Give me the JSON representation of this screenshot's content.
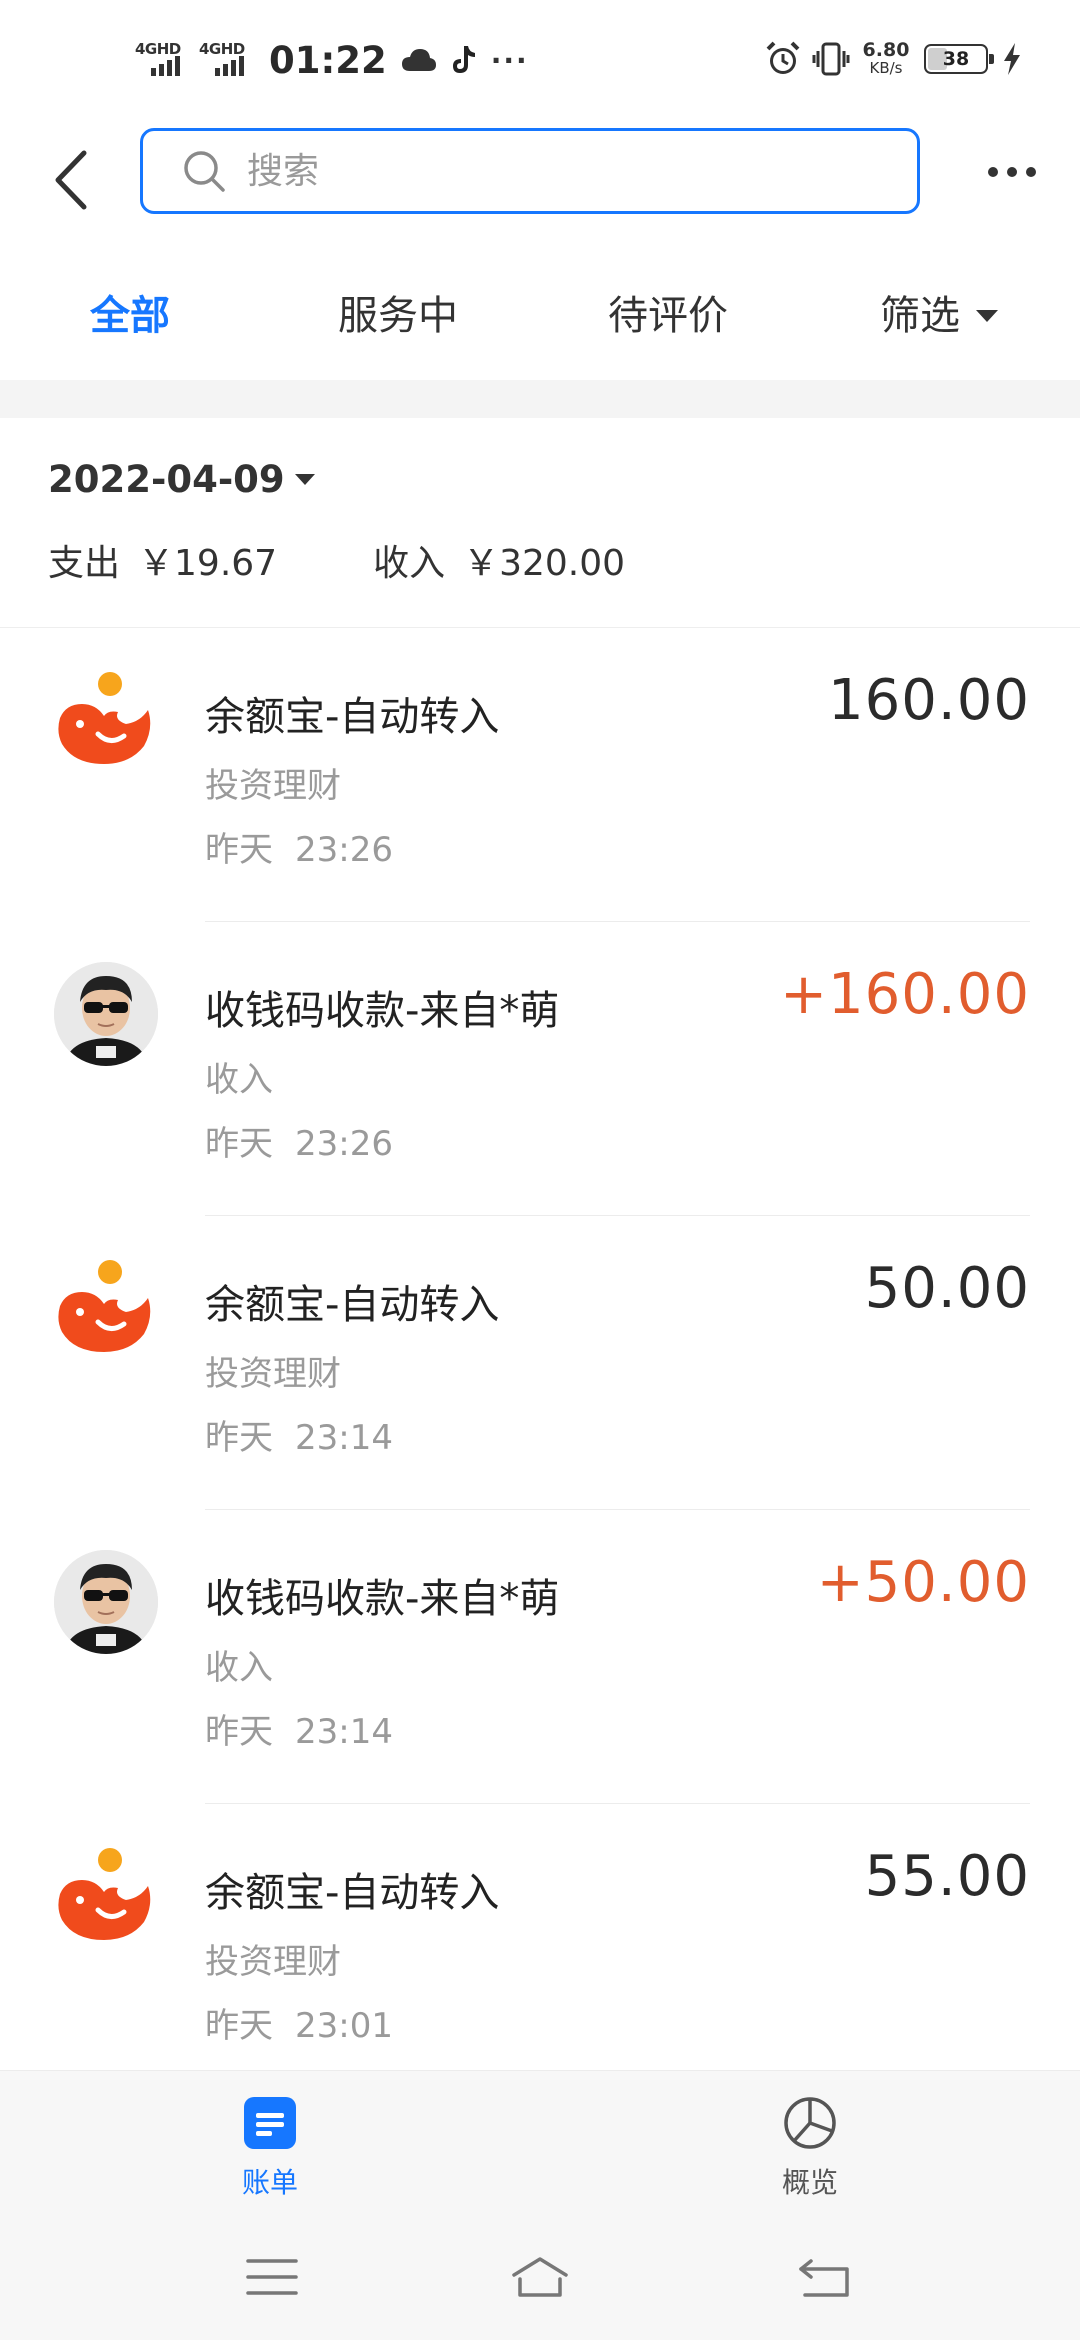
{
  "status_bar": {
    "network_1": "4GHD",
    "network_2": "4GHD",
    "time": "01:22",
    "overflow": "···",
    "speed_value": "6.80",
    "speed_unit": "KB/s",
    "battery": "38"
  },
  "header": {
    "search_placeholder": "搜索"
  },
  "tabs": [
    {
      "label": "全部",
      "active": true
    },
    {
      "label": "服务中",
      "active": false
    },
    {
      "label": "待评价",
      "active": false
    },
    {
      "label": "筛选",
      "active": false
    }
  ],
  "summary": {
    "date": "2022-04-09",
    "expense_label": "支出",
    "expense_value": "￥19.67",
    "income_label": "收入",
    "income_value": "￥320.00"
  },
  "transactions": [
    {
      "icon": "yuebao-icon",
      "title": "余额宝-自动转入",
      "category": "投资理财",
      "day": "昨天",
      "time": "23:26",
      "amount": "160.00",
      "type": "neutral"
    },
    {
      "icon": "user-avatar",
      "title": "收钱码收款-来自*萌",
      "category": "收入",
      "day": "昨天",
      "time": "23:26",
      "amount": "+160.00",
      "type": "income"
    },
    {
      "icon": "yuebao-icon",
      "title": "余额宝-自动转入",
      "category": "投资理财",
      "day": "昨天",
      "time": "23:14",
      "amount": "50.00",
      "type": "neutral"
    },
    {
      "icon": "user-avatar",
      "title": "收钱码收款-来自*萌",
      "category": "收入",
      "day": "昨天",
      "time": "23:14",
      "amount": "+50.00",
      "type": "income"
    },
    {
      "icon": "yuebao-icon",
      "title": "余额宝-自动转入",
      "category": "投资理财",
      "day": "昨天",
      "time": "23:01",
      "amount": "55.00",
      "type": "neutral"
    }
  ],
  "bottom_nav": {
    "bill_label": "账单",
    "overview_label": "概览"
  },
  "colors": {
    "accent": "#1677ff",
    "income": "#e15d2e",
    "yuebao": "#f04b1c"
  }
}
